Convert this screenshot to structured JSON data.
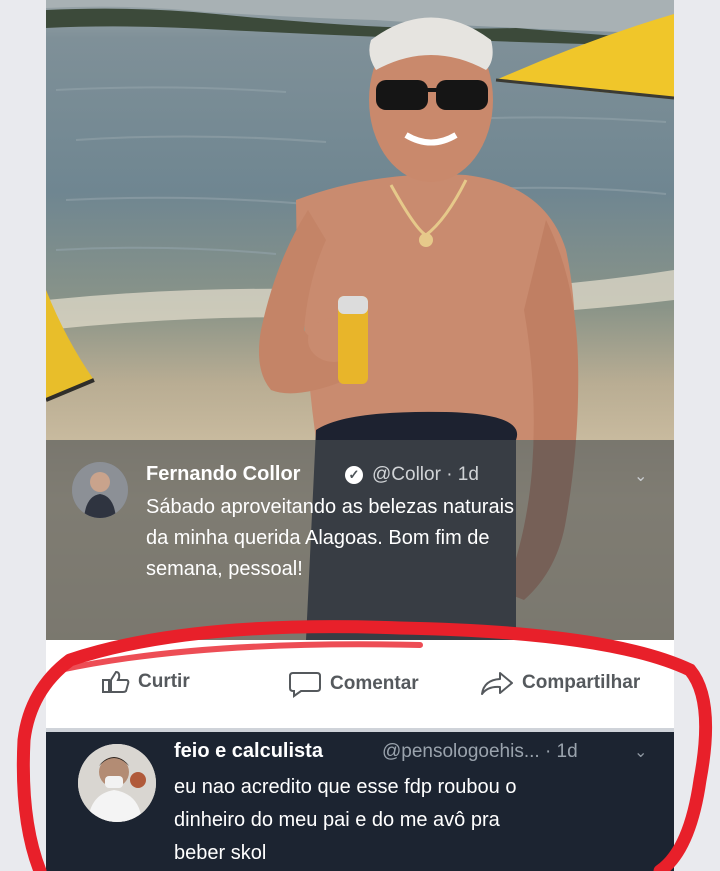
{
  "tweet": {
    "author_name": "Fernando Collor",
    "author_handle": "@Collor · 1d",
    "text_lines": [
      "Sábado aproveitando as belezas naturais",
      "da minha querida Alagoas. Bom fim de",
      "semana, pessoal!"
    ]
  },
  "actions": {
    "like_label": "Curtir",
    "comment_label": "Comentar",
    "share_label": "Compartilhar"
  },
  "reply": {
    "author_name": "feio e calculista",
    "author_handle": "@pensologoehis... · 1d",
    "text_lines": [
      "eu nao acredito que esse fdp roubou o",
      "dinheiro do meu pai e do me avô pra",
      "beber skol"
    ]
  },
  "colors": {
    "annotation_circle": "#e8202a",
    "reply_background": "#1c2431",
    "overlay": "#484e50"
  },
  "icons": {
    "verified": "verified-badge-icon",
    "chevron": "chevron-down-icon",
    "like": "thumbs-up-icon",
    "comment": "speech-bubble-icon",
    "share": "share-arrow-icon"
  }
}
